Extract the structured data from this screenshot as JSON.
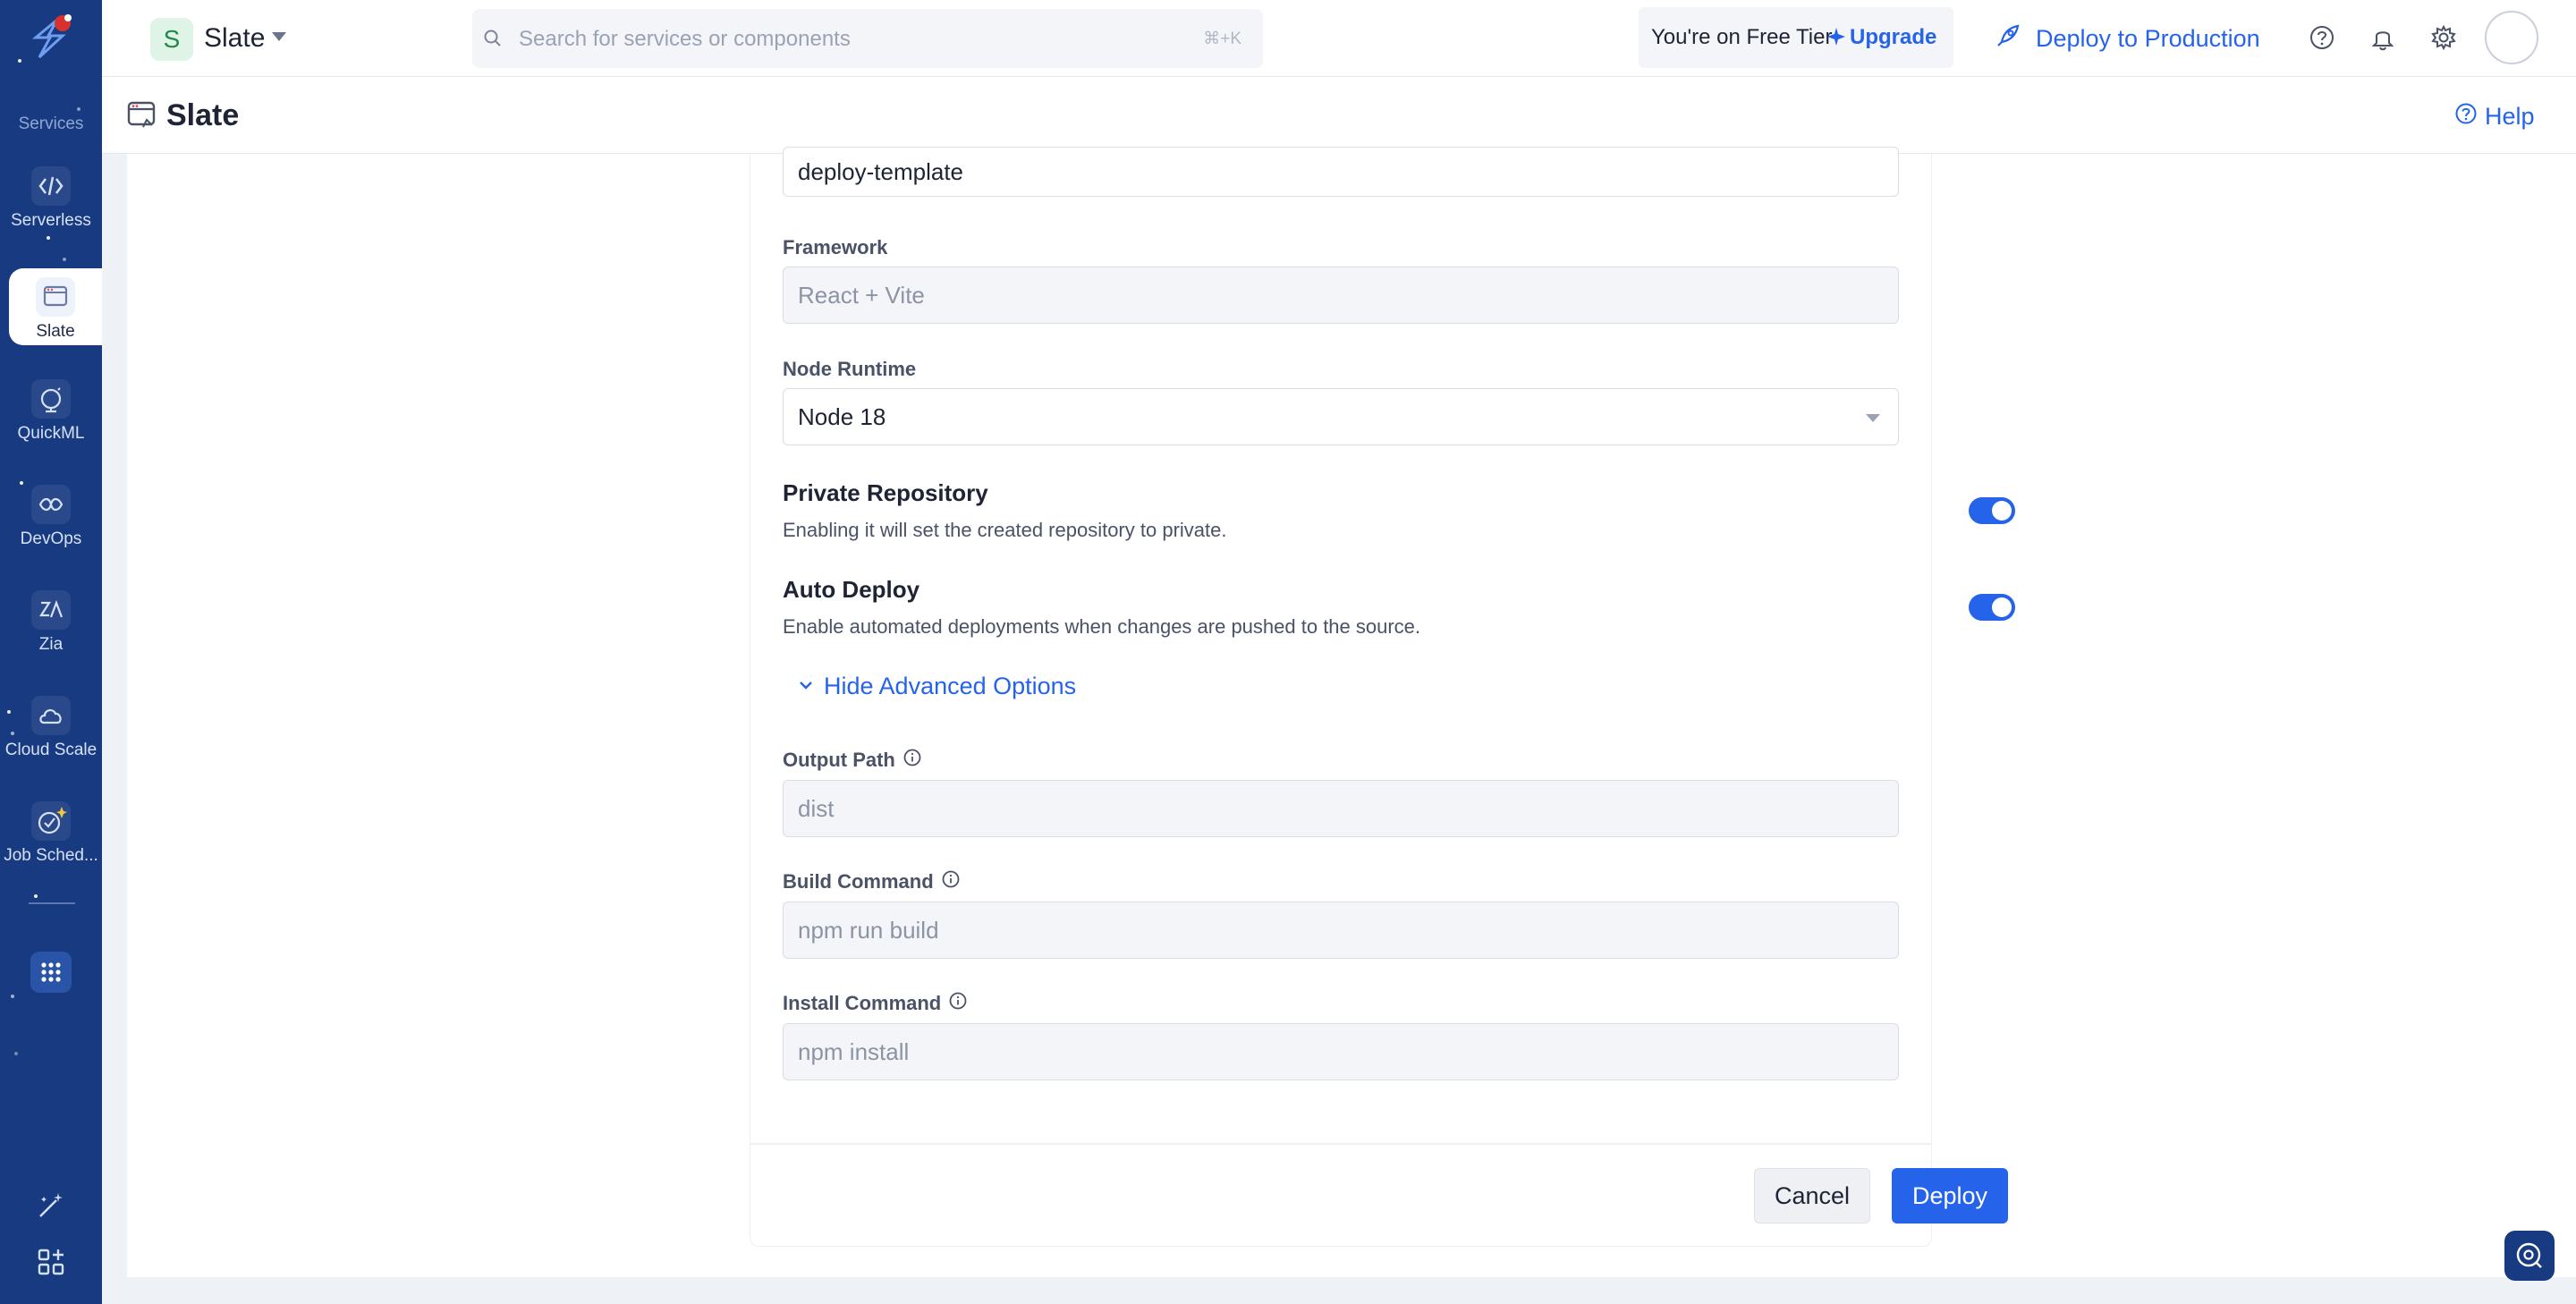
{
  "rail": {
    "services_label": "Services",
    "items": [
      {
        "label": "Serverless",
        "icon": "serverless-icon"
      },
      {
        "label": "Slate",
        "icon": "slate-icon"
      },
      {
        "label": "QuickML",
        "icon": "quickml-icon"
      },
      {
        "label": "DevOps",
        "icon": "devops-icon"
      },
      {
        "label": "Zia",
        "icon": "zia-icon"
      },
      {
        "label": "Cloud Scale",
        "icon": "cloud-scale-icon"
      },
      {
        "label": "Job Sched...",
        "icon": "job-scheduler-icon"
      }
    ]
  },
  "topbar": {
    "project_initial": "S",
    "project_name": "Slate",
    "search_placeholder": "Search for services or components",
    "search_shortcut": "⌘+K",
    "tier_text": "You're on Free Tier",
    "upgrade_label": "Upgrade",
    "deploy_prod_label": "Deploy to Production"
  },
  "subbar": {
    "title": "Slate",
    "help_label": "Help"
  },
  "form": {
    "name_value": "deploy-template",
    "framework_label": "Framework",
    "framework_value": "React + Vite",
    "runtime_label": "Node Runtime",
    "runtime_value": "Node 18",
    "private_repo_title": "Private Repository",
    "private_repo_desc": "Enabling it will set the created repository to private.",
    "private_repo_on": true,
    "auto_deploy_title": "Auto Deploy",
    "auto_deploy_desc": "Enable automated deployments when changes are pushed to the source.",
    "auto_deploy_on": true,
    "advanced_toggle_label": "Hide Advanced Options",
    "output_path_label": "Output Path",
    "output_path_placeholder": "dist",
    "build_command_label": "Build Command",
    "build_command_placeholder": "npm run build",
    "install_command_label": "Install Command",
    "install_command_placeholder": "npm install",
    "cancel_label": "Cancel",
    "deploy_label": "Deploy"
  },
  "colors": {
    "rail": "#173a80",
    "accent": "#2563eb"
  }
}
